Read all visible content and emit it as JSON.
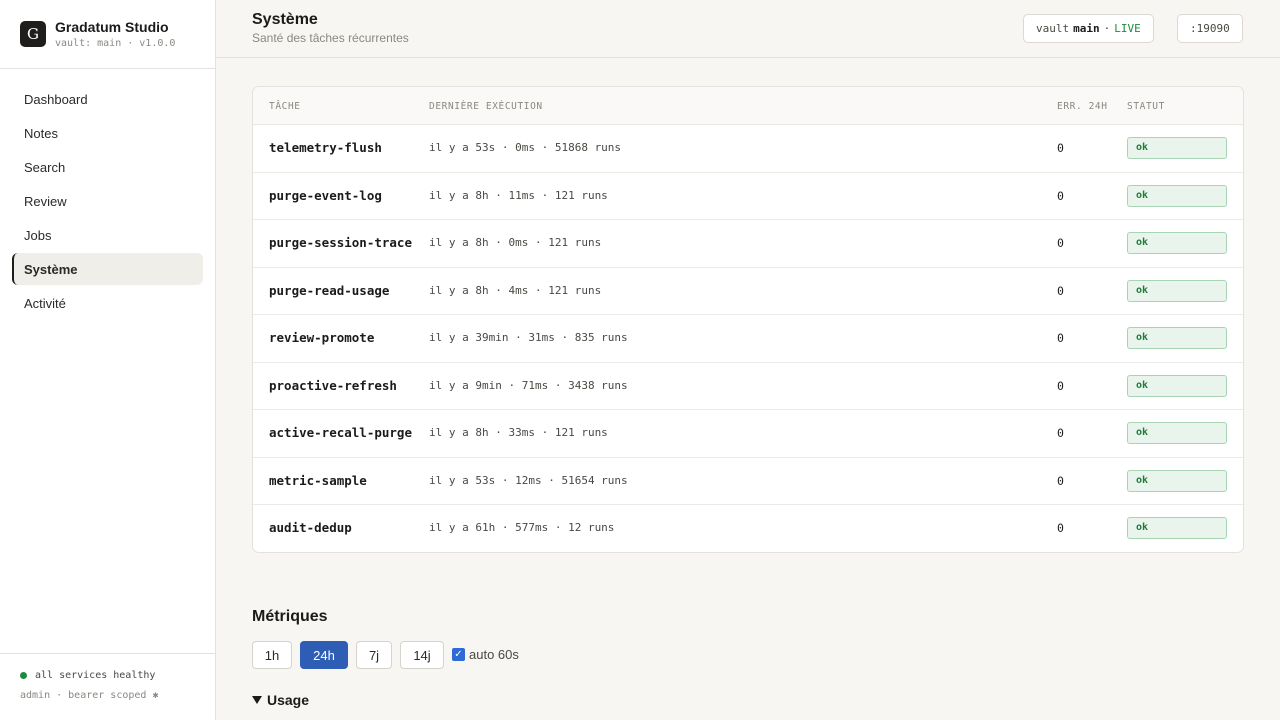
{
  "app": {
    "logo_letter": "G",
    "name": "Gradatum Studio",
    "vault_info": "vault: main · v1.0.0"
  },
  "sidebar": {
    "items": [
      {
        "label": "Dashboard"
      },
      {
        "label": "Notes"
      },
      {
        "label": "Search"
      },
      {
        "label": "Review"
      },
      {
        "label": "Jobs"
      },
      {
        "label": "Système",
        "active": true
      },
      {
        "label": "Activité"
      }
    ],
    "footer": {
      "health": "all services healthy",
      "admin": "admin · bearer scoped ✱"
    }
  },
  "header": {
    "title": "Système",
    "subtitle": "Santé des tâches récurrentes",
    "vault_label": "vault",
    "vault_name": "main",
    "separator": "·",
    "live": "LIVE",
    "port": ":19090"
  },
  "table": {
    "columns": {
      "task": "TÂCHE",
      "last_run": "DERNIÈRE EXÉCUTION",
      "errors": "ERR. 24H",
      "status": "STATUT"
    },
    "rows": [
      {
        "name": "telemetry-flush",
        "last": "il y a 53s · 0ms · 51868 runs",
        "errors": "0",
        "status": "ok"
      },
      {
        "name": "purge-event-log",
        "last": "il y a 8h · 11ms · 121 runs",
        "errors": "0",
        "status": "ok"
      },
      {
        "name": "purge-session-trace",
        "last": "il y a 8h · 0ms · 121 runs",
        "errors": "0",
        "status": "ok"
      },
      {
        "name": "purge-read-usage",
        "last": "il y a 8h · 4ms · 121 runs",
        "errors": "0",
        "status": "ok"
      },
      {
        "name": "review-promote",
        "last": "il y a 39min · 31ms · 835 runs",
        "errors": "0",
        "status": "ok"
      },
      {
        "name": "proactive-refresh",
        "last": "il y a 9min · 71ms · 3438 runs",
        "errors": "0",
        "status": "ok"
      },
      {
        "name": "active-recall-purge",
        "last": "il y a 8h · 33ms · 121 runs",
        "errors": "0",
        "status": "ok"
      },
      {
        "name": "metric-sample",
        "last": "il y a 53s · 12ms · 51654 runs",
        "errors": "0",
        "status": "ok"
      },
      {
        "name": "audit-dedup",
        "last": "il y a 61h · 577ms · 12 runs",
        "errors": "0",
        "status": "ok"
      }
    ]
  },
  "metrics": {
    "title": "Métriques",
    "ranges": [
      "1h",
      "24h",
      "7j",
      "14j"
    ],
    "selected_range": "24h",
    "auto_refresh_label": "auto 60s",
    "auto_refresh_checked": true,
    "usage_label": "Usage"
  },
  "colors": {
    "accent": "#2d5db4",
    "ok_green": "#1e7a3a",
    "live_green": "#1e8a3f"
  }
}
